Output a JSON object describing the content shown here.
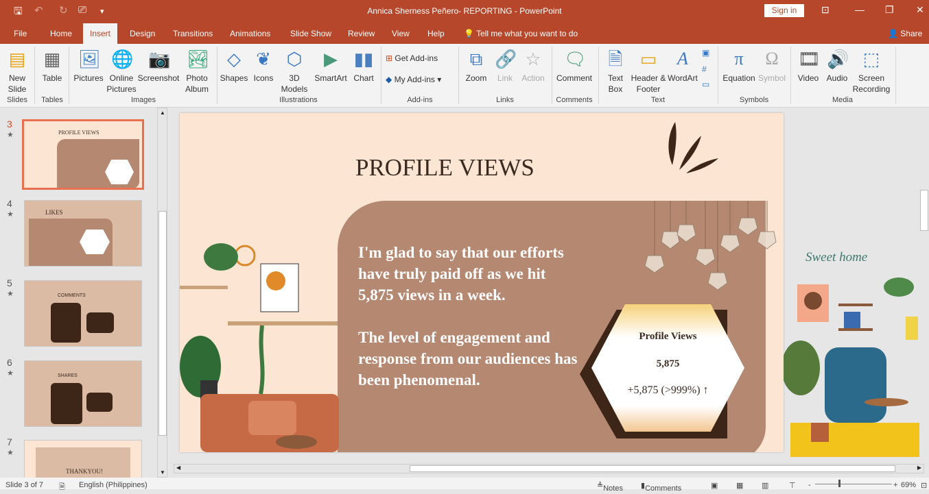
{
  "window": {
    "title": "Annica Sherness Peñero- REPORTING  -  PowerPoint",
    "sign_in": "Sign in",
    "share": "Share"
  },
  "tabs": [
    "File",
    "Home",
    "Insert",
    "Design",
    "Transitions",
    "Animations",
    "Slide Show",
    "Review",
    "View",
    "Help"
  ],
  "tell_me": "Tell me what you want to do",
  "ribbon": {
    "new_slide": "New Slide",
    "table": "Table",
    "pictures": "Pictures",
    "online_pictures": "Online Pictures",
    "screenshot": "Screenshot",
    "photo_album": "Photo Album",
    "shapes": "Shapes",
    "icons": "Icons",
    "models": "3D Models",
    "smartart": "SmartArt",
    "chart": "Chart",
    "get_addins": "Get Add-ins",
    "my_addins": "My Add-ins",
    "zoom": "Zoom",
    "link": "Link",
    "action": "Action",
    "comment": "Comment",
    "text_box": "Text Box",
    "header_footer": "Header & Footer",
    "wordart": "WordArt",
    "equation": "Equation",
    "symbol": "Symbol",
    "video": "Video",
    "audio": "Audio",
    "screen_recording": "Screen Recording",
    "groups": {
      "slides": "Slides",
      "tables": "Tables",
      "images": "Images",
      "illustrations": "Illustrations",
      "addins": "Add-ins",
      "links": "Links",
      "comments": "Comments",
      "text": "Text",
      "symbols": "Symbols",
      "media": "Media"
    }
  },
  "thumbnails": [
    {
      "num": "3",
      "title": "PROFILE VIEWS"
    },
    {
      "num": "4",
      "title": "LIKES"
    },
    {
      "num": "5",
      "title": "COMMENTS"
    },
    {
      "num": "6",
      "title": "SHARES"
    },
    {
      "num": "7",
      "title": "THANKYOU!"
    }
  ],
  "slide": {
    "title": "PROFILE VIEWS",
    "para1": "I'm glad to say that our efforts have truly paid off as we hit 5,875 views in a week.",
    "para2": "The level of engagement and response from our audiences has been phenomenal.",
    "card_title": "Profile Views",
    "card_value": "5,875",
    "card_change": "+5,875 (>999%) ↑",
    "side_text": "Sweet home"
  },
  "status": {
    "slide": "Slide 3 of 7",
    "language": "English (Philippines)",
    "notes": "Notes",
    "comments": "Comments",
    "zoom": "69%"
  }
}
